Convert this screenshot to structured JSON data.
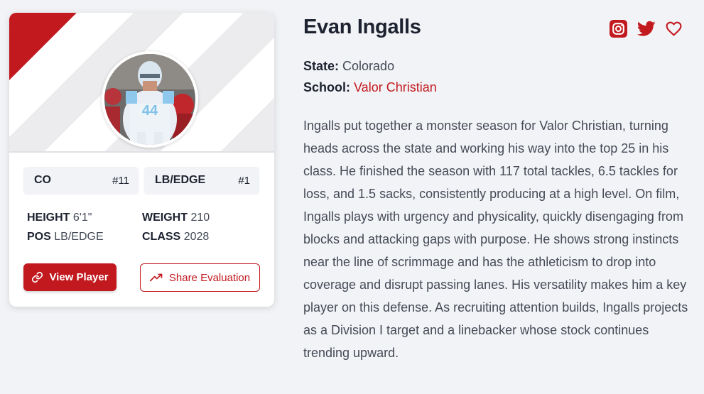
{
  "player": {
    "name": "Evan Ingalls",
    "state_label": "State:",
    "state": "Colorado",
    "school_label": "School:",
    "school": "Valor Christian",
    "bio": "Ingalls put together a monster season for Valor Christian, turning heads across the state and working his way into the top 25 in his class. He finished the season with 117 total tackles, 6.5 tackles for loss, and 1.5 sacks, consistently producing at a high level. On film, Ingalls plays with urgency and physicality, quickly disengaging from blocks and attacking gaps with purpose. He shows strong instincts near the line of scrimmage and has the athleticism to drop into coverage and disrupt passing lanes. His versatility makes him a key player on this defense. As recruiting attention builds, Ingalls projects as a Division I target and a linebacker whose stock continues trending upward."
  },
  "card": {
    "rankings": [
      {
        "label": "CO",
        "rank": "#11"
      },
      {
        "label": "LB/EDGE",
        "rank": "#1"
      }
    ],
    "stats": [
      {
        "key": "HEIGHT",
        "value": "6'1\""
      },
      {
        "key": "WEIGHT",
        "value": "210"
      },
      {
        "key": "POS",
        "value": "LB/EDGE"
      },
      {
        "key": "CLASS",
        "value": "2028"
      }
    ],
    "view_button": "View Player",
    "share_button": "Share Evaluation"
  },
  "icons": {
    "social": [
      "instagram-icon",
      "twitter-icon",
      "heart-icon"
    ],
    "view": "link-icon",
    "share": "trending-up-icon"
  },
  "colors": {
    "accent": "#c2191f",
    "background": "#f2f3f6",
    "text": "#1d2230",
    "muted": "#444a56"
  }
}
